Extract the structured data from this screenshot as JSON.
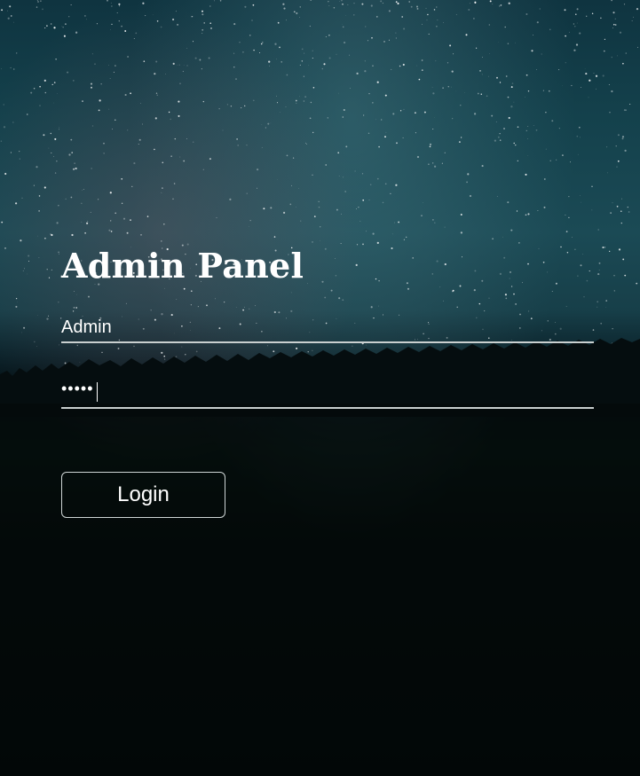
{
  "page": {
    "title": "Admin Panel"
  },
  "login": {
    "username_value": "Admin",
    "password_value": "•••••",
    "button_label": "Login"
  }
}
